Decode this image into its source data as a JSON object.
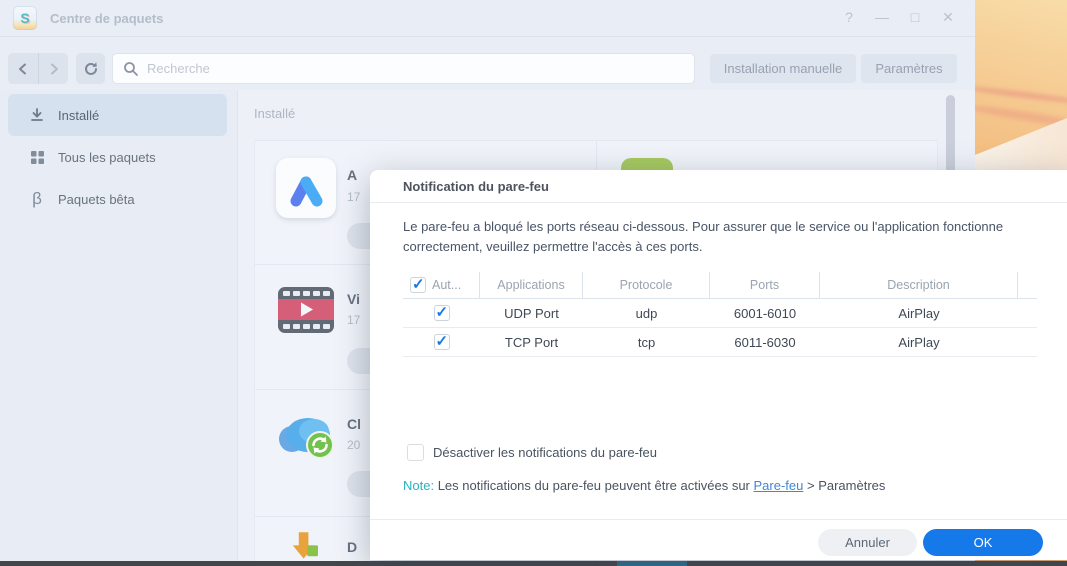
{
  "colors": {
    "accent_blue": "#1579ea",
    "check_blue": "#1878e8",
    "link_blue": "#4087d5",
    "note_teal": "#26b3c3",
    "selected_item_bg": "#d6e1f0",
    "taskbar_dark": "#43474c"
  },
  "window": {
    "title": "Centre de paquets",
    "controls": {
      "help": "?",
      "minimize": "—",
      "maximize": "□",
      "close": "✕"
    }
  },
  "toolbar": {
    "search_placeholder": "Recherche",
    "manual_install_label": "Installation manuelle",
    "settings_label": "Paramètres"
  },
  "sidebar": {
    "items": [
      {
        "label": "Installé",
        "icon": "download-icon",
        "selected": true
      },
      {
        "label": "Tous les paquets",
        "icon": "grid-icon",
        "selected": false
      },
      {
        "label": "Paquets bêta",
        "icon": "beta-icon",
        "glyph": "β",
        "selected": false
      }
    ]
  },
  "content": {
    "heading": "Installé",
    "packages": [
      {
        "icon": "triangle-app-icon",
        "name_fragment": "A",
        "version_fragment": "17"
      },
      {
        "icon": "video-station-icon",
        "name_fragment": "Vi",
        "version_fragment": "17"
      },
      {
        "icon": "cloud-sync-icon",
        "name_fragment": "Cl",
        "version_fragment": "20"
      },
      {
        "icon": "download-station-icon",
        "name_fragment": "D",
        "version_fragment": ""
      }
    ]
  },
  "dialog": {
    "title": "Notification du pare-feu",
    "body_text": "Le pare-feu a bloqué les ports réseau ci-dessous. Pour assurer que le service ou l'application fonctionne correctement, veuillez permettre l'accès à ces ports.",
    "table": {
      "columns": [
        "Aut...",
        "Applications",
        "Protocole",
        "Ports",
        "Description"
      ],
      "rows": [
        {
          "allowed": true,
          "application": "UDP Port",
          "protocol": "udp",
          "ports": "6001-6010",
          "description": "AirPlay"
        },
        {
          "allowed": true,
          "application": "TCP Port",
          "protocol": "tcp",
          "ports": "6011-6030",
          "description": "AirPlay"
        }
      ]
    },
    "disable_checkbox_label": "Désactiver les notifications du pare-feu",
    "note": {
      "prefix": "Note:",
      "before_link": " Les notifications du pare-feu peuvent être activées sur ",
      "link_label": "Pare-feu",
      "after_link": " > Paramètres"
    },
    "buttons": {
      "cancel": "Annuler",
      "ok": "OK"
    }
  }
}
